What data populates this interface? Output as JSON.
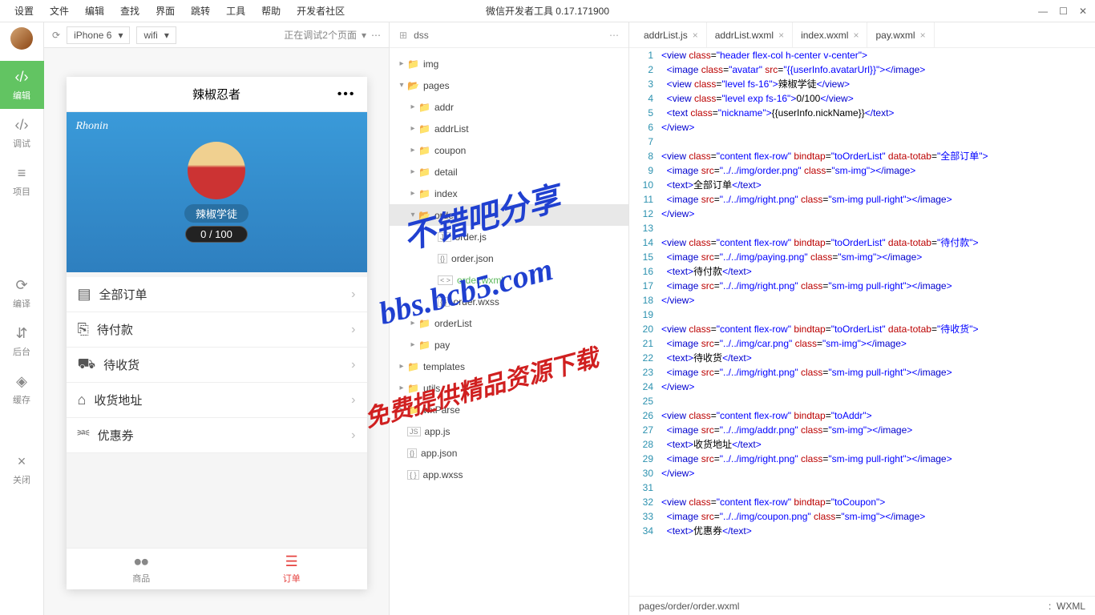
{
  "menubar": {
    "items": [
      "设置",
      "文件",
      "编辑",
      "查找",
      "界面",
      "跳转",
      "工具",
      "帮助",
      "开发者社区"
    ],
    "title": "微信开发者工具 0.17.171900"
  },
  "sidebar": {
    "tools": [
      {
        "icon": "‹/›",
        "label": "编辑",
        "active": true
      },
      {
        "icon": "‹/›",
        "label": "调试"
      },
      {
        "icon": "≡",
        "label": "项目"
      },
      {
        "icon": "⟳",
        "label": "编译"
      },
      {
        "icon": "⇵",
        "label": "后台"
      },
      {
        "icon": "◈",
        "label": "缓存"
      },
      {
        "icon": "×",
        "label": "关闭"
      }
    ]
  },
  "sim": {
    "device": "iPhone 6",
    "network": "wifi",
    "debugText": "正在调试2个页面"
  },
  "phone": {
    "title": "辣椒忍者",
    "username": "Rhonin",
    "badge": "辣椒学徒",
    "exp": "0 / 100",
    "menus": [
      {
        "icon": "▤",
        "text": "全部订单"
      },
      {
        "icon": "⎘",
        "text": "待付款"
      },
      {
        "icon": "⛟",
        "text": "待收货"
      },
      {
        "icon": "⌂",
        "text": "收货地址"
      },
      {
        "icon": "⎃",
        "text": "优惠券"
      }
    ],
    "tabs": [
      {
        "icon": "⦁⦁",
        "text": "商品",
        "active": false
      },
      {
        "icon": "☰",
        "text": "订单",
        "active": true
      }
    ]
  },
  "filetree": {
    "root": "dss",
    "items": [
      {
        "d": 0,
        "chev": "▸",
        "type": "folder",
        "name": "img"
      },
      {
        "d": 0,
        "chev": "▾",
        "type": "folder-open",
        "name": "pages"
      },
      {
        "d": 1,
        "chev": "▸",
        "type": "folder",
        "name": "addr"
      },
      {
        "d": 1,
        "chev": "▸",
        "type": "folder",
        "name": "addrList"
      },
      {
        "d": 1,
        "chev": "▸",
        "type": "folder",
        "name": "coupon"
      },
      {
        "d": 1,
        "chev": "▸",
        "type": "folder",
        "name": "detail"
      },
      {
        "d": 1,
        "chev": "▸",
        "type": "folder",
        "name": "index"
      },
      {
        "d": 1,
        "chev": "▾",
        "type": "folder-open",
        "name": "order",
        "sel": true
      },
      {
        "d": 2,
        "chev": "",
        "type": "js",
        "name": "order.js"
      },
      {
        "d": 2,
        "chev": "",
        "type": "json",
        "name": "order.json"
      },
      {
        "d": 2,
        "chev": "",
        "type": "wxml",
        "name": "order.wxml",
        "green": true
      },
      {
        "d": 2,
        "chev": "",
        "type": "wxss",
        "name": "order.wxss"
      },
      {
        "d": 1,
        "chev": "▸",
        "type": "folder",
        "name": "orderList"
      },
      {
        "d": 1,
        "chev": "▸",
        "type": "folder",
        "name": "pay"
      },
      {
        "d": 0,
        "chev": "▸",
        "type": "folder",
        "name": "templates"
      },
      {
        "d": 0,
        "chev": "▸",
        "type": "folder",
        "name": "utils"
      },
      {
        "d": 0,
        "chev": "▸",
        "type": "folder",
        "name": "wxParse"
      },
      {
        "d": 0,
        "chev": "",
        "type": "js",
        "name": "app.js"
      },
      {
        "d": 0,
        "chev": "",
        "type": "json",
        "name": "app.json"
      },
      {
        "d": 0,
        "chev": "",
        "type": "wxss",
        "name": "app.wxss"
      }
    ]
  },
  "editorTabs": [
    {
      "name": "addrList.js"
    },
    {
      "name": "addrList.wxml"
    },
    {
      "name": "index.wxml"
    },
    {
      "name": "pay.wxml"
    }
  ],
  "code": [
    {
      "n": 1,
      "html": "<span class='t-pun'>&lt;</span><span class='t-tag'>view</span> <span class='t-attr'>class</span>=<span class='t-str'>\"header flex-col h-center v-center\"</span><span class='t-pun'>&gt;</span>"
    },
    {
      "n": 2,
      "html": "  <span class='t-pun'>&lt;</span><span class='t-tag'>image</span> <span class='t-attr'>class</span>=<span class='t-str'>\"avatar\"</span> <span class='t-attr'>src</span>=<span class='t-str'>\"{{userInfo.avatarUrl}}\"</span><span class='t-pun'>&gt;&lt;/</span><span class='t-tag'>image</span><span class='t-pun'>&gt;</span>"
    },
    {
      "n": 3,
      "html": "  <span class='t-pun'>&lt;</span><span class='t-tag'>view</span> <span class='t-attr'>class</span>=<span class='t-str'>\"level fs-16\"</span><span class='t-pun'>&gt;</span><span class='t-txt'>辣椒学徒</span><span class='t-pun'>&lt;/</span><span class='t-tag'>view</span><span class='t-pun'>&gt;</span>"
    },
    {
      "n": 4,
      "html": "  <span class='t-pun'>&lt;</span><span class='t-tag'>view</span> <span class='t-attr'>class</span>=<span class='t-str'>\"level exp fs-16\"</span><span class='t-pun'>&gt;</span><span class='t-txt'>0/100</span><span class='t-pun'>&lt;/</span><span class='t-tag'>view</span><span class='t-pun'>&gt;</span>"
    },
    {
      "n": 5,
      "html": "  <span class='t-pun'>&lt;</span><span class='t-tag'>text</span> <span class='t-attr'>class</span>=<span class='t-str'>\"nickname\"</span><span class='t-pun'>&gt;</span><span class='t-txt'>{{userInfo.nickName}}</span><span class='t-pun'>&lt;/</span><span class='t-tag'>text</span><span class='t-pun'>&gt;</span>"
    },
    {
      "n": 6,
      "html": "<span class='t-pun'>&lt;/</span><span class='t-tag'>view</span><span class='t-pun'>&gt;</span>"
    },
    {
      "n": 7,
      "html": ""
    },
    {
      "n": 8,
      "html": "<span class='t-pun'>&lt;</span><span class='t-tag'>view</span> <span class='t-attr'>class</span>=<span class='t-str'>\"content flex-row\"</span> <span class='t-attr'>bindtap</span>=<span class='t-str'>\"toOrderList\"</span> <span class='t-attr'>data-totab</span>=<span class='t-str'>\"全部订单\"</span><span class='t-pun'>&gt;</span>"
    },
    {
      "n": 9,
      "html": "  <span class='t-pun'>&lt;</span><span class='t-tag'>image</span> <span class='t-attr'>src</span>=<span class='t-str'>\"../../img/order.png\"</span> <span class='t-attr'>class</span>=<span class='t-str'>\"sm-img\"</span><span class='t-pun'>&gt;&lt;/</span><span class='t-tag'>image</span><span class='t-pun'>&gt;</span>"
    },
    {
      "n": 10,
      "html": "  <span class='t-pun'>&lt;</span><span class='t-tag'>text</span><span class='t-pun'>&gt;</span><span class='t-txt'>全部订单</span><span class='t-pun'>&lt;/</span><span class='t-tag'>text</span><span class='t-pun'>&gt;</span>"
    },
    {
      "n": 11,
      "html": "  <span class='t-pun'>&lt;</span><span class='t-tag'>image</span> <span class='t-attr'>src</span>=<span class='t-str'>\"../../img/right.png\"</span> <span class='t-attr'>class</span>=<span class='t-str'>\"sm-img pull-right\"</span><span class='t-pun'>&gt;&lt;/</span><span class='t-tag'>image</span><span class='t-pun'>&gt;</span>"
    },
    {
      "n": 12,
      "html": "<span class='t-pun'>&lt;/</span><span class='t-tag'>view</span><span class='t-pun'>&gt;</span>"
    },
    {
      "n": 13,
      "html": ""
    },
    {
      "n": 14,
      "html": "<span class='t-pun'>&lt;</span><span class='t-tag'>view</span> <span class='t-attr'>class</span>=<span class='t-str'>\"content flex-row\"</span> <span class='t-attr'>bindtap</span>=<span class='t-str'>\"toOrderList\"</span> <span class='t-attr'>data-totab</span>=<span class='t-str'>\"待付款\"</span><span class='t-pun'>&gt;</span>"
    },
    {
      "n": 15,
      "html": "  <span class='t-pun'>&lt;</span><span class='t-tag'>image</span> <span class='t-attr'>src</span>=<span class='t-str'>\"../../img/paying.png\"</span> <span class='t-attr'>class</span>=<span class='t-str'>\"sm-img\"</span><span class='t-pun'>&gt;&lt;/</span><span class='t-tag'>image</span><span class='t-pun'>&gt;</span>"
    },
    {
      "n": 16,
      "html": "  <span class='t-pun'>&lt;</span><span class='t-tag'>text</span><span class='t-pun'>&gt;</span><span class='t-txt'>待付款</span><span class='t-pun'>&lt;/</span><span class='t-tag'>text</span><span class='t-pun'>&gt;</span>"
    },
    {
      "n": 17,
      "html": "  <span class='t-pun'>&lt;</span><span class='t-tag'>image</span> <span class='t-attr'>src</span>=<span class='t-str'>\"../../img/right.png\"</span> <span class='t-attr'>class</span>=<span class='t-str'>\"sm-img pull-right\"</span><span class='t-pun'>&gt;&lt;/</span><span class='t-tag'>image</span><span class='t-pun'>&gt;</span>"
    },
    {
      "n": 18,
      "html": "<span class='t-pun'>&lt;/</span><span class='t-tag'>view</span><span class='t-pun'>&gt;</span>"
    },
    {
      "n": 19,
      "html": ""
    },
    {
      "n": 20,
      "html": "<span class='t-pun'>&lt;</span><span class='t-tag'>view</span> <span class='t-attr'>class</span>=<span class='t-str'>\"content flex-row\"</span> <span class='t-attr'>bindtap</span>=<span class='t-str'>\"toOrderList\"</span> <span class='t-attr'>data-totab</span>=<span class='t-str'>\"待收货\"</span><span class='t-pun'>&gt;</span>"
    },
    {
      "n": 21,
      "html": "  <span class='t-pun'>&lt;</span><span class='t-tag'>image</span> <span class='t-attr'>src</span>=<span class='t-str'>\"../../img/car.png\"</span> <span class='t-attr'>class</span>=<span class='t-str'>\"sm-img\"</span><span class='t-pun'>&gt;&lt;/</span><span class='t-tag'>image</span><span class='t-pun'>&gt;</span>"
    },
    {
      "n": 22,
      "html": "  <span class='t-pun'>&lt;</span><span class='t-tag'>text</span><span class='t-pun'>&gt;</span><span class='t-txt'>待收货</span><span class='t-pun'>&lt;/</span><span class='t-tag'>text</span><span class='t-pun'>&gt;</span>"
    },
    {
      "n": 23,
      "html": "  <span class='t-pun'>&lt;</span><span class='t-tag'>image</span> <span class='t-attr'>src</span>=<span class='t-str'>\"../../img/right.png\"</span> <span class='t-attr'>class</span>=<span class='t-str'>\"sm-img pull-right\"</span><span class='t-pun'>&gt;&lt;/</span><span class='t-tag'>image</span><span class='t-pun'>&gt;</span>"
    },
    {
      "n": 24,
      "html": "<span class='t-pun'>&lt;/</span><span class='t-tag'>view</span><span class='t-pun'>&gt;</span>"
    },
    {
      "n": 25,
      "html": ""
    },
    {
      "n": 26,
      "html": "<span class='t-pun'>&lt;</span><span class='t-tag'>view</span> <span class='t-attr'>class</span>=<span class='t-str'>\"content flex-row\"</span> <span class='t-attr'>bindtap</span>=<span class='t-str'>\"toAddr\"</span><span class='t-pun'>&gt;</span>"
    },
    {
      "n": 27,
      "html": "  <span class='t-pun'>&lt;</span><span class='t-tag'>image</span> <span class='t-attr'>src</span>=<span class='t-str'>\"../../img/addr.png\"</span> <span class='t-attr'>class</span>=<span class='t-str'>\"sm-img\"</span><span class='t-pun'>&gt;&lt;/</span><span class='t-tag'>image</span><span class='t-pun'>&gt;</span>"
    },
    {
      "n": 28,
      "html": "  <span class='t-pun'>&lt;</span><span class='t-tag'>text</span><span class='t-pun'>&gt;</span><span class='t-txt'>收货地址</span><span class='t-pun'>&lt;/</span><span class='t-tag'>text</span><span class='t-pun'>&gt;</span>"
    },
    {
      "n": 29,
      "html": "  <span class='t-pun'>&lt;</span><span class='t-tag'>image</span> <span class='t-attr'>src</span>=<span class='t-str'>\"../../img/right.png\"</span> <span class='t-attr'>class</span>=<span class='t-str'>\"sm-img pull-right\"</span><span class='t-pun'>&gt;&lt;/</span><span class='t-tag'>image</span><span class='t-pun'>&gt;</span>"
    },
    {
      "n": 30,
      "html": "<span class='t-pun'>&lt;/</span><span class='t-tag'>view</span><span class='t-pun'>&gt;</span>"
    },
    {
      "n": 31,
      "html": ""
    },
    {
      "n": 32,
      "html": "<span class='t-pun'>&lt;</span><span class='t-tag'>view</span> <span class='t-attr'>class</span>=<span class='t-str'>\"content flex-row\"</span> <span class='t-attr'>bindtap</span>=<span class='t-str'>\"toCoupon\"</span><span class='t-pun'>&gt;</span>"
    },
    {
      "n": 33,
      "html": "  <span class='t-pun'>&lt;</span><span class='t-tag'>image</span> <span class='t-attr'>src</span>=<span class='t-str'>\"../../img/coupon.png\"</span> <span class='t-attr'>class</span>=<span class='t-str'>\"sm-img\"</span><span class='t-pun'>&gt;&lt;/</span><span class='t-tag'>image</span><span class='t-pun'>&gt;</span>"
    },
    {
      "n": 34,
      "html": "  <span class='t-pun'>&lt;</span><span class='t-tag'>text</span><span class='t-pun'>&gt;</span><span class='t-txt'>优惠券</span><span class='t-pun'>&lt;/</span><span class='t-tag'>text</span><span class='t-pun'>&gt;</span>"
    }
  ],
  "statusbar": {
    "path": "pages/order/order.wxml",
    "lang": "WXML"
  },
  "watermark": {
    "a": "不错吧分享",
    "b": "bbs.bcb5.com",
    "c": "免费提供精品资源下载"
  }
}
